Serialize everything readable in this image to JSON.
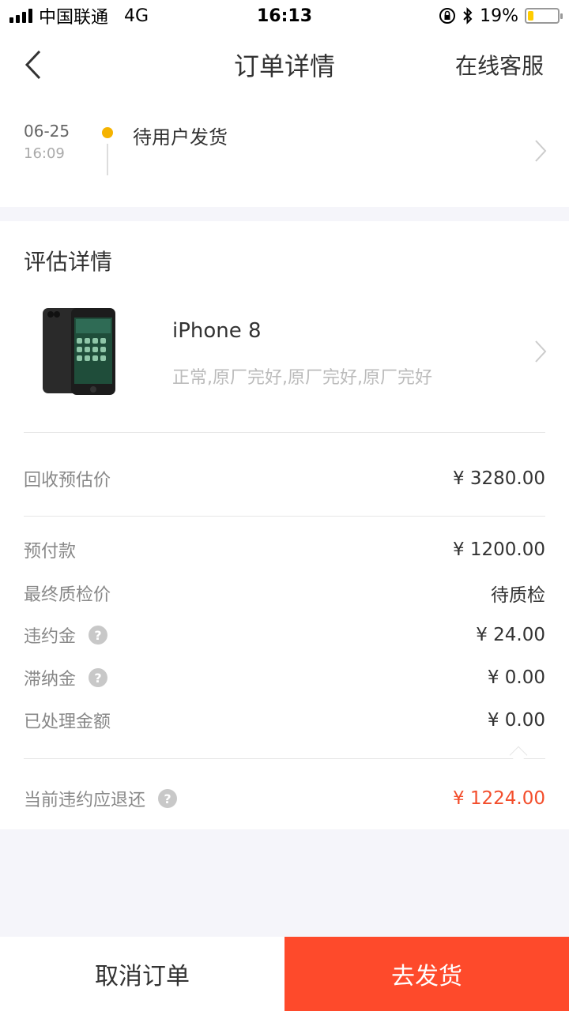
{
  "status_bar": {
    "carrier": "中国联通",
    "network": "4G",
    "time": "16:13",
    "battery_text": "19%",
    "battery_level": 0.19
  },
  "nav": {
    "title": "订单详情",
    "right_label": "在线客服",
    "back_icon": "chevron-left-icon"
  },
  "order_status": {
    "date": "06-25",
    "time": "16:09",
    "text": "待用户发货",
    "dot_color": "#f5b300"
  },
  "evaluation": {
    "title": "评估详情",
    "product": {
      "name": "iPhone 8",
      "description": "正常,原厂完好,原厂完好,原厂完好"
    },
    "estimate_label": "回收预估价",
    "estimate_value": "¥ 3280.00",
    "rows": [
      {
        "label": "预付款",
        "value": "¥ 1200.00",
        "help": false
      },
      {
        "label": "最终质检价",
        "value": "待质检",
        "help": false
      },
      {
        "label": "违约金",
        "value": "¥ 24.00",
        "help": true
      },
      {
        "label": "滞纳金",
        "value": "¥ 0.00",
        "help": true
      },
      {
        "label": "已处理金额",
        "value": "¥ 0.00",
        "help": false
      }
    ],
    "refund_label": "当前违约应退还",
    "refund_value": "¥ 1224.00",
    "help_glyph": "?"
  },
  "actions": {
    "cancel_label": "取消订单",
    "ship_label": "去发货"
  },
  "colors": {
    "accent": "#fe4a2b",
    "refund_red": "#f34e2c",
    "status_dot": "#f5b300"
  }
}
